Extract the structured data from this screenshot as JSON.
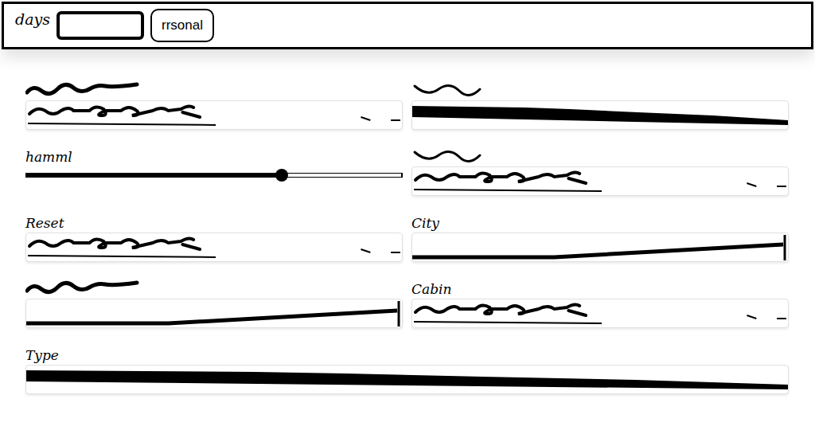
{
  "header": {
    "title": "days",
    "button": "rrsonal"
  },
  "fields": [
    {
      "label_kind": "scribble",
      "label": "",
      "kind": "select"
    },
    {
      "label_kind": "scribble",
      "label": "",
      "kind": "bar"
    },
    {
      "label_kind": "text",
      "label": "hamml",
      "kind": "slider",
      "level": 0.68
    },
    {
      "label_kind": "scribble",
      "label": "",
      "kind": "select"
    },
    {
      "label_kind": "text",
      "label": "Reset",
      "kind": "select"
    },
    {
      "label_kind": "text",
      "label": "City",
      "kind": "input"
    },
    {
      "label_kind": "scribble",
      "label": "",
      "kind": "input"
    },
    {
      "label_kind": "text",
      "label": "Cabin",
      "kind": "select"
    },
    {
      "label_kind": "text",
      "label": "Type",
      "kind": "bar"
    }
  ]
}
